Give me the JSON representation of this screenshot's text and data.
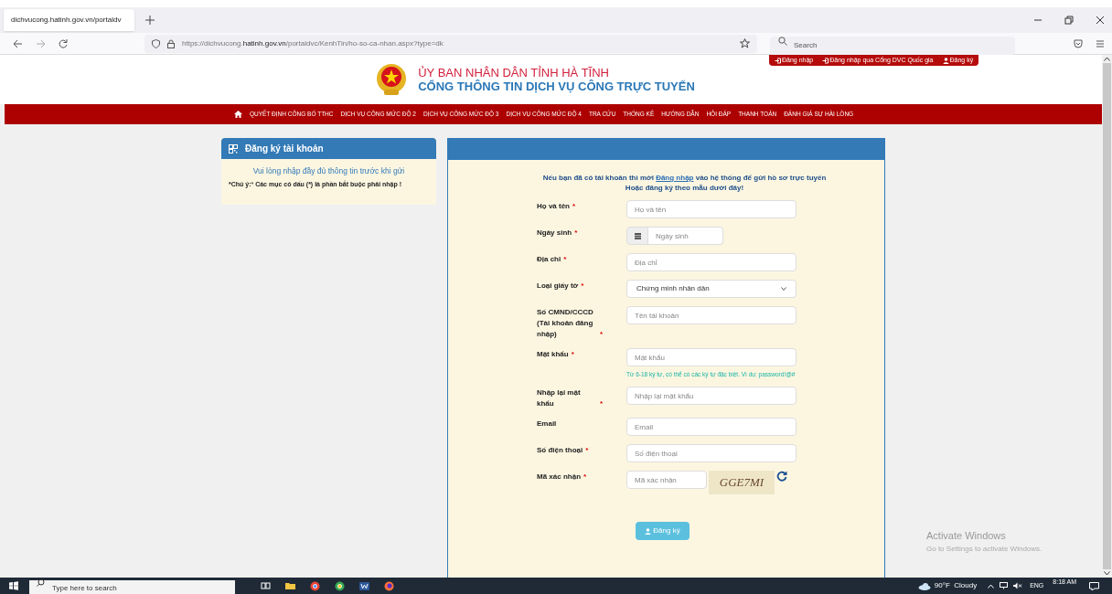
{
  "browser": {
    "tab": {
      "title": "dichvucong.hatinh.gov.vn/portaldv",
      "selected": true
    },
    "address": {
      "prefix": "https://dichvucong.",
      "domain": "hatinh.gov.vn",
      "path": "/portaldvc/KenhTin/ho-so-ca-nhan.aspx?type=dk"
    },
    "search": {
      "placeholder": "Search"
    }
  },
  "top_links": [
    {
      "label": "Đăng nhập",
      "kind": "login"
    },
    {
      "label": "Đăng nhập qua Cổng DVC Quốc gia",
      "kind": "login"
    },
    {
      "label": "Đăng ký",
      "kind": "user"
    }
  ],
  "header": {
    "title": "ỦY BAN NHÂN DÂN TỈNH HÀ TĨNH",
    "subtitle": "CỔNG THÔNG TIN DỊCH VỤ CÔNG TRỰC TUYẾN"
  },
  "menu": [
    "QUYẾT ĐỊNH CÔNG BỐ TTHC",
    "DỊCH VỤ CÔNG MỨC ĐỘ 2",
    "DỊCH VỤ CÔNG MỨC ĐỘ 3",
    "DỊCH VỤ CÔNG MỨC ĐỘ 4",
    "TRA CỨU",
    "THỐNG KÊ",
    "HƯỚNG DẪN",
    "HỎI ĐÁP",
    "THANH TOÁN",
    "ĐÁNH GIÁ SỰ HÀI LÒNG"
  ],
  "side_panel": {
    "title": "Đăng ký tài khoản",
    "message": "Vui lòng nhập đầy đủ thông tin trước khi gửi",
    "note": "***Chú ý:*** **Các mục có dấu (*) là phần bắt buộc phải nhập !**"
  },
  "form": {
    "intro": "Nếu bạn đã có tài khoản thì mời",
    "intro_link": "Đăng nhập",
    "intro_rest": "vào hệ thống để gửi hồ sơ trực tuyến",
    "intro_line2": "Hoặc đăng ký theo mẫu dưới đây!",
    "fields": [
      {
        "label": "Họ và tên",
        "required": true,
        "kind": "text",
        "placeholder": "Họ và tên"
      },
      {
        "label": "Ngày sinh",
        "required": true,
        "kind": "date",
        "placeholder": "Ngày sinh"
      },
      {
        "label": "Địa chỉ",
        "required": true,
        "kind": "text",
        "placeholder": "Địa chỉ"
      },
      {
        "label": "Loại giấy tờ",
        "required": true,
        "kind": "select",
        "value": "Chứng minh nhân dân"
      },
      {
        "label": "Số CMND/CCCD (Tài khoản đăng nhập)",
        "required": true,
        "kind": "text",
        "placeholder": "Tên tài khoản"
      },
      {
        "label": "Mật khẩu",
        "required": true,
        "kind": "text",
        "placeholder": "Mật khẩu",
        "hint": "Từ 6-18 ký tự, có thể có các ký tự đặc biệt. Ví dụ: password!@#"
      },
      {
        "label": "Nhập lại mật khẩu",
        "required": true,
        "kind": "text",
        "placeholder": "Nhập lại mật khẩu"
      },
      {
        "label": "Email",
        "required": false,
        "kind": "text",
        "placeholder": "Email"
      },
      {
        "label": "Số điện thoại",
        "required": true,
        "kind": "text",
        "placeholder": "Số điện thoại"
      },
      {
        "label": "Mã xác nhận",
        "required": true,
        "kind": "captcha",
        "placeholder": "Mã xác nhận",
        "captcha": "GGE7MI"
      }
    ],
    "required_mark": "*",
    "submit": "Đăng ký"
  },
  "activation": {
    "title": "Activate Windows",
    "text": "Go to Settings to activate Windows."
  },
  "taskbar": {
    "search_placeholder": "Type here to search",
    "weather": "90°F  Cloudy",
    "language": "ENG",
    "time": "8:18 AM"
  }
}
